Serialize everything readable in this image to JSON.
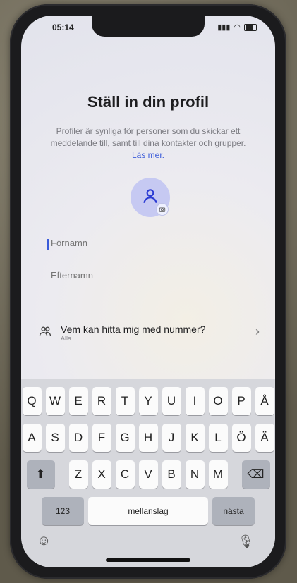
{
  "status": {
    "time": "05:14"
  },
  "title": "Ställ in din profil",
  "description": "Profiler är synliga för personer som du skickar ett meddelande till, samt till dina kontakter och grupper.",
  "learn_more": "Läs mer.",
  "fields": {
    "first_name_placeholder": "Förnamn",
    "last_name_placeholder": "Efternamn"
  },
  "find_me": {
    "label": "Vem kan hitta mig med nummer?",
    "value": "Alla"
  },
  "keyboard": {
    "row1": [
      "Q",
      "W",
      "E",
      "R",
      "T",
      "Y",
      "U",
      "I",
      "O",
      "P",
      "Å"
    ],
    "row2": [
      "A",
      "S",
      "D",
      "F",
      "G",
      "H",
      "J",
      "K",
      "L",
      "Ö",
      "Ä"
    ],
    "row3": [
      "Z",
      "X",
      "C",
      "V",
      "B",
      "N",
      "M"
    ],
    "numbers_key": "123",
    "space_key": "mellanslag",
    "next_key": "nästa"
  },
  "icons": {
    "avatar": "person-icon",
    "camera": "camera-icon",
    "contacts": "people-icon",
    "chevron": "chevron-right-icon",
    "shift": "shift-icon",
    "backspace": "backspace-icon",
    "emoji": "emoji-icon",
    "mic": "mic-icon"
  },
  "colors": {
    "accent": "#3a5bd9",
    "avatar_bg": "#c6c9f2"
  }
}
